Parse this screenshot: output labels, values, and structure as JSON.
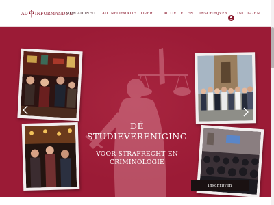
{
  "header": {
    "logo_left": "AD",
    "logo_right": "INFORMANDUM",
    "nav": [
      {
        "label": "MIJN AD INFO",
        "name": "nav-mijn-ad-info"
      },
      {
        "label": "AD INFORMATIE",
        "name": "nav-ad-informatie"
      },
      {
        "label": "OVER",
        "name": "nav-over"
      },
      {
        "label": "ACTIVITEITEN",
        "name": "nav-activiteiten"
      },
      {
        "label": "INSCHRIJVEN",
        "name": "nav-inschrijven"
      }
    ],
    "login_label": "INLOGGEN"
  },
  "hero": {
    "headline_line1": "DÉ",
    "headline_line2": "STUDIEVERENIGING",
    "subline_line1": "VOOR STRAFRECHT EN",
    "subline_line2": "CRIMINOLOGIE",
    "signup_label": "Inschrijven"
  },
  "colors": {
    "brand": "#8a1a2e",
    "hero_background": "#9b1b36",
    "button_background": "#1a1112",
    "text_light": "#ffffff"
  },
  "icons": {
    "logo": "scales-of-justice-icon",
    "login": "user-avatar-icon",
    "carousel_prev": "chevron-left-icon",
    "carousel_next": "chevron-right-icon"
  }
}
